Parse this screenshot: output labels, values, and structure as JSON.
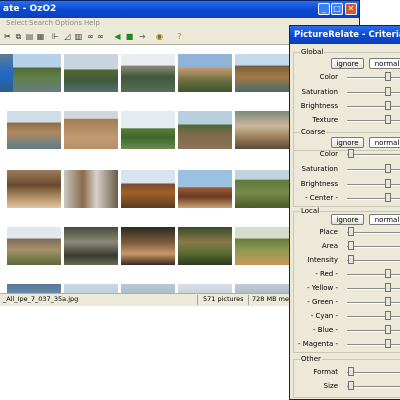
{
  "main_window": {
    "title": "ate - OzO2",
    "menu": [
      "Select",
      "Search",
      "Options",
      "Help"
    ],
    "status": {
      "filename": "_All_Ipe_7_037_35a.jpg",
      "count": "571 pictures",
      "memory": "728 MB memor"
    }
  },
  "dialog": {
    "title": "PictureRelate - Criterias",
    "groups": [
      {
        "label": "Global",
        "ignore": "ignore",
        "normal": "normal",
        "rows": [
          "Color",
          "Saturation",
          "Brightness",
          "Texture"
        ]
      },
      {
        "label": "Coarse",
        "ignore": "ignore",
        "normal": "normal",
        "rows": [
          "Color",
          "Saturation",
          "Brightness",
          "- Center -"
        ]
      },
      {
        "label": "Local",
        "ignore": "ignore",
        "normal": "normal",
        "rows": [
          "Place",
          "Area",
          "Intensity",
          "- Red -",
          "- Yellow -",
          "- Green -",
          "- Cyan -",
          "- Blue -",
          "- Magenta -"
        ]
      },
      {
        "label": "Other",
        "rows": [
          "Format",
          "Size"
        ]
      }
    ]
  },
  "colors": {
    "titlebar": "#0a4bd8",
    "face": "#ece9d8"
  }
}
